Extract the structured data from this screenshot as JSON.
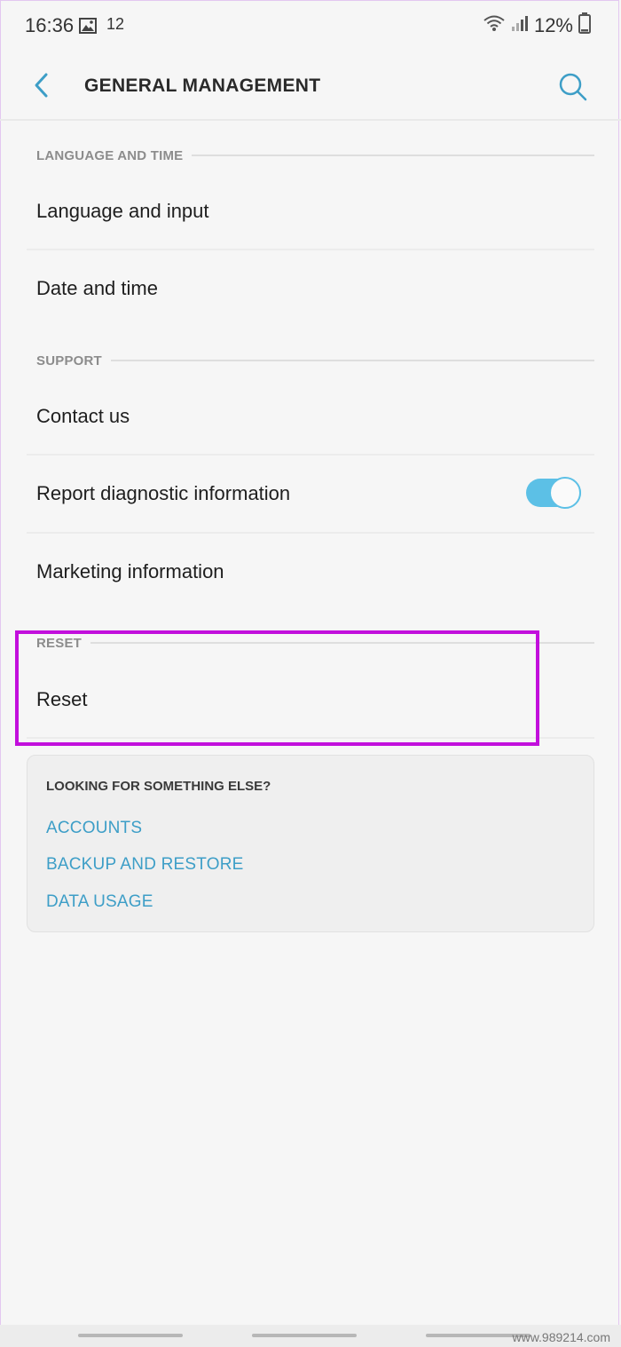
{
  "status_bar": {
    "time": "16:36",
    "notification_count": "12",
    "battery_percent": "12%"
  },
  "header": {
    "title": "GENERAL MANAGEMENT",
    "back_icon": "chevron-left-icon",
    "search_icon": "search-icon"
  },
  "sections": {
    "language_time": {
      "label": "LANGUAGE AND TIME",
      "items": [
        "Language and input",
        "Date and time"
      ]
    },
    "support": {
      "label": "SUPPORT",
      "items": [
        "Contact us",
        "Report diagnostic information",
        "Marketing information"
      ]
    },
    "reset": {
      "label": "RESET",
      "items": [
        "Reset"
      ]
    }
  },
  "toggles": {
    "report_diagnostic": true
  },
  "looking_for": {
    "title": "LOOKING FOR SOMETHING ELSE?",
    "links": [
      "ACCOUNTS",
      "BACKUP AND RESTORE",
      "DATA USAGE"
    ]
  },
  "watermark": "www.989214.com",
  "colors": {
    "accent": "#3d9ec7",
    "toggle_on": "#5cc0e6",
    "highlight": "#c20fdc",
    "background": "#f6f6f6"
  }
}
